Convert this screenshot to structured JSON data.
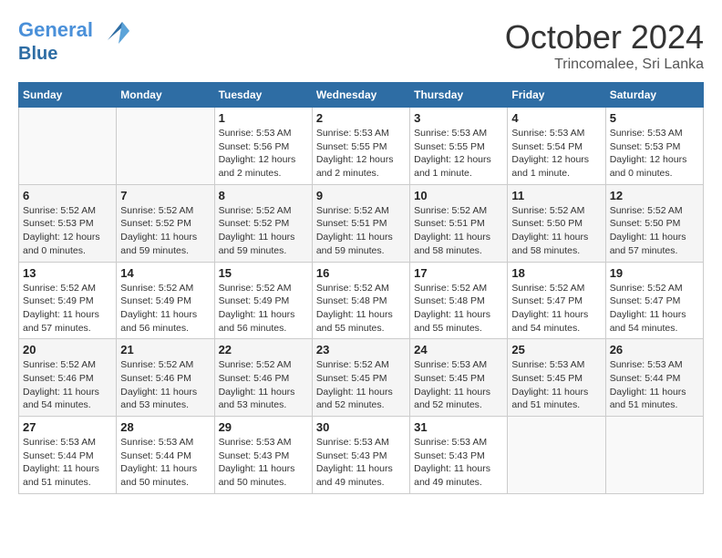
{
  "header": {
    "logo_line1": "General",
    "logo_line2": "Blue",
    "month": "October 2024",
    "location": "Trincomalee, Sri Lanka"
  },
  "weekdays": [
    "Sunday",
    "Monday",
    "Tuesday",
    "Wednesday",
    "Thursday",
    "Friday",
    "Saturday"
  ],
  "weeks": [
    [
      {
        "day": "",
        "info": ""
      },
      {
        "day": "",
        "info": ""
      },
      {
        "day": "1",
        "info": "Sunrise: 5:53 AM\nSunset: 5:56 PM\nDaylight: 12 hours and 2 minutes."
      },
      {
        "day": "2",
        "info": "Sunrise: 5:53 AM\nSunset: 5:55 PM\nDaylight: 12 hours and 2 minutes."
      },
      {
        "day": "3",
        "info": "Sunrise: 5:53 AM\nSunset: 5:55 PM\nDaylight: 12 hours and 1 minute."
      },
      {
        "day": "4",
        "info": "Sunrise: 5:53 AM\nSunset: 5:54 PM\nDaylight: 12 hours and 1 minute."
      },
      {
        "day": "5",
        "info": "Sunrise: 5:53 AM\nSunset: 5:53 PM\nDaylight: 12 hours and 0 minutes."
      }
    ],
    [
      {
        "day": "6",
        "info": "Sunrise: 5:52 AM\nSunset: 5:53 PM\nDaylight: 12 hours and 0 minutes."
      },
      {
        "day": "7",
        "info": "Sunrise: 5:52 AM\nSunset: 5:52 PM\nDaylight: 11 hours and 59 minutes."
      },
      {
        "day": "8",
        "info": "Sunrise: 5:52 AM\nSunset: 5:52 PM\nDaylight: 11 hours and 59 minutes."
      },
      {
        "day": "9",
        "info": "Sunrise: 5:52 AM\nSunset: 5:51 PM\nDaylight: 11 hours and 59 minutes."
      },
      {
        "day": "10",
        "info": "Sunrise: 5:52 AM\nSunset: 5:51 PM\nDaylight: 11 hours and 58 minutes."
      },
      {
        "day": "11",
        "info": "Sunrise: 5:52 AM\nSunset: 5:50 PM\nDaylight: 11 hours and 58 minutes."
      },
      {
        "day": "12",
        "info": "Sunrise: 5:52 AM\nSunset: 5:50 PM\nDaylight: 11 hours and 57 minutes."
      }
    ],
    [
      {
        "day": "13",
        "info": "Sunrise: 5:52 AM\nSunset: 5:49 PM\nDaylight: 11 hours and 57 minutes."
      },
      {
        "day": "14",
        "info": "Sunrise: 5:52 AM\nSunset: 5:49 PM\nDaylight: 11 hours and 56 minutes."
      },
      {
        "day": "15",
        "info": "Sunrise: 5:52 AM\nSunset: 5:49 PM\nDaylight: 11 hours and 56 minutes."
      },
      {
        "day": "16",
        "info": "Sunrise: 5:52 AM\nSunset: 5:48 PM\nDaylight: 11 hours and 55 minutes."
      },
      {
        "day": "17",
        "info": "Sunrise: 5:52 AM\nSunset: 5:48 PM\nDaylight: 11 hours and 55 minutes."
      },
      {
        "day": "18",
        "info": "Sunrise: 5:52 AM\nSunset: 5:47 PM\nDaylight: 11 hours and 54 minutes."
      },
      {
        "day": "19",
        "info": "Sunrise: 5:52 AM\nSunset: 5:47 PM\nDaylight: 11 hours and 54 minutes."
      }
    ],
    [
      {
        "day": "20",
        "info": "Sunrise: 5:52 AM\nSunset: 5:46 PM\nDaylight: 11 hours and 54 minutes."
      },
      {
        "day": "21",
        "info": "Sunrise: 5:52 AM\nSunset: 5:46 PM\nDaylight: 11 hours and 53 minutes."
      },
      {
        "day": "22",
        "info": "Sunrise: 5:52 AM\nSunset: 5:46 PM\nDaylight: 11 hours and 53 minutes."
      },
      {
        "day": "23",
        "info": "Sunrise: 5:52 AM\nSunset: 5:45 PM\nDaylight: 11 hours and 52 minutes."
      },
      {
        "day": "24",
        "info": "Sunrise: 5:53 AM\nSunset: 5:45 PM\nDaylight: 11 hours and 52 minutes."
      },
      {
        "day": "25",
        "info": "Sunrise: 5:53 AM\nSunset: 5:45 PM\nDaylight: 11 hours and 51 minutes."
      },
      {
        "day": "26",
        "info": "Sunrise: 5:53 AM\nSunset: 5:44 PM\nDaylight: 11 hours and 51 minutes."
      }
    ],
    [
      {
        "day": "27",
        "info": "Sunrise: 5:53 AM\nSunset: 5:44 PM\nDaylight: 11 hours and 51 minutes."
      },
      {
        "day": "28",
        "info": "Sunrise: 5:53 AM\nSunset: 5:44 PM\nDaylight: 11 hours and 50 minutes."
      },
      {
        "day": "29",
        "info": "Sunrise: 5:53 AM\nSunset: 5:43 PM\nDaylight: 11 hours and 50 minutes."
      },
      {
        "day": "30",
        "info": "Sunrise: 5:53 AM\nSunset: 5:43 PM\nDaylight: 11 hours and 49 minutes."
      },
      {
        "day": "31",
        "info": "Sunrise: 5:53 AM\nSunset: 5:43 PM\nDaylight: 11 hours and 49 minutes."
      },
      {
        "day": "",
        "info": ""
      },
      {
        "day": "",
        "info": ""
      }
    ]
  ]
}
